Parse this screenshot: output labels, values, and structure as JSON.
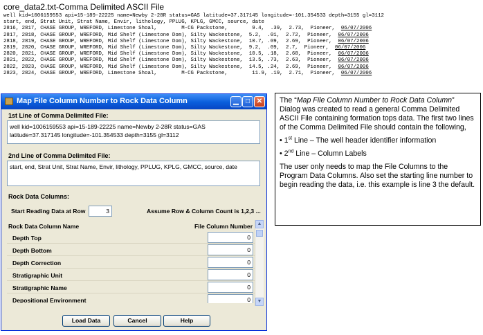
{
  "file": {
    "title": "core_data2.txt-Comma Delimited ASCII File",
    "lines": [
      "well kid=1006159553 api=15-189-22225 name=Newby 2-28R status=GAS latitude=37.317145 longitude=-101.354533 depth=3155 gl=3112",
      "start, end, Strat Unit, Strat Name, Envir, lithology, PPLUG, KPLG, GMCC, source, date",
      "2816, 2817, CHASE GROUP, WREFORD, Limestone Shoal,        M-CG Packstone,        9.4,  .39,  2.73,  Pioneer,  06/07/2006",
      "2817, 2818, CHASE GROUP, WREFORD, Mid Shelf (Limestone Dom), Silty Wackestone,  5.2,  .01,  2.72,  Pioneer,  06/07/2006",
      "2818, 2819, CHASE GROUP, WREFORD, Mid Shelf (Limestone Dom), Silty Wackestone,  10.7, .09,  2.69,  Pioneer,  06/07/2006",
      "2819, 2820, CHASE GROUP, WREFORD, Mid Shelf (Limestone Dom), Silty Wackestone,  9.2,  .09,  2.7,  Pioneer,  06/07/2006",
      "2820, 2821, CHASE GROUP, WREFORD, Mid Shelf (Limestone Dom), Silty Wackestone,  10.5, .18,  2.68,  Pioneer,  06/07/2006",
      "2821, 2822, CHASE GROUP, WREFORD, Mid Shelf (Limestone Dom), Silty Wackestone,  13.5, .73,  2.63,  Pioneer,  06/07/2006",
      "2822, 2823, CHASE GROUP, WREFORD, Mid Shelf (Limestone Dom), Silty Wackestone,  14.5, .24,  2.69,  Pioneer,  06/07/2006",
      "2823, 2824, CHASE GROUP, WREFORD, Limestone Shoal,        M-CG Packstone,        11.9, .19,  2.71,  Pioneer,  06/07/2006"
    ]
  },
  "dialog": {
    "title": "Map File Column Number to Rock Data Column",
    "first_line_label": "1st Line of Comma Delimited File:",
    "first_line_text": [
      "well kid=1006159553 api=15-189-22225 name=Newby 2-28R status=GAS",
      "latitude=37.317145 longitude=-101.354533 depth=3155 gl=3112"
    ],
    "second_line_label": "2nd Line of Comma Delimited File:",
    "second_line_text": "start, end, Strat Unit, Strat Name, Envir, lithology, PPLUG, KPLG, GMCC, source, date",
    "rock_section_label": "Rock Data Columns:",
    "start_row_label": "Start Reading Data at Row",
    "start_row_value": "3",
    "assume_label": "Assume Row & Column Count is 1,2,3 ...",
    "col_name_header": "Rock Data Column Name",
    "col_num_header": "File Column Number",
    "rows": [
      {
        "label": "Depth Top",
        "value": "0"
      },
      {
        "label": "Depth Bottom",
        "value": "0"
      },
      {
        "label": "Depth Correction",
        "value": "0"
      },
      {
        "label": "Stratigraphic Unit",
        "value": "0"
      },
      {
        "label": "Stratigraphic Name",
        "value": "0"
      },
      {
        "label": "Depositional Environment",
        "value": "0"
      }
    ],
    "buttons": {
      "load": "Load Data",
      "cancel": "Cancel",
      "help": "Help"
    }
  },
  "note": {
    "p1_pre": "The “",
    "p1_italic": "Map File Column Number to Rock Data Column",
    "p1_post": "” Dialog was created to read a general Comma Delimited ASCII File containing formation tops data. The first two lines of the Comma Delimited File should contain the following,",
    "b1_num": "1",
    "b1_sup": "st",
    "b1_text": " Line – The well header identifier information",
    "b2_num": "2",
    "b2_sup": "nd",
    "b2_text": " Line – Column Labels",
    "p2": "The user only needs to map the File Columns to the Program Data Columns.  Also set the starting line number to begin reading the data, i.e. this example is line 3 the default."
  }
}
